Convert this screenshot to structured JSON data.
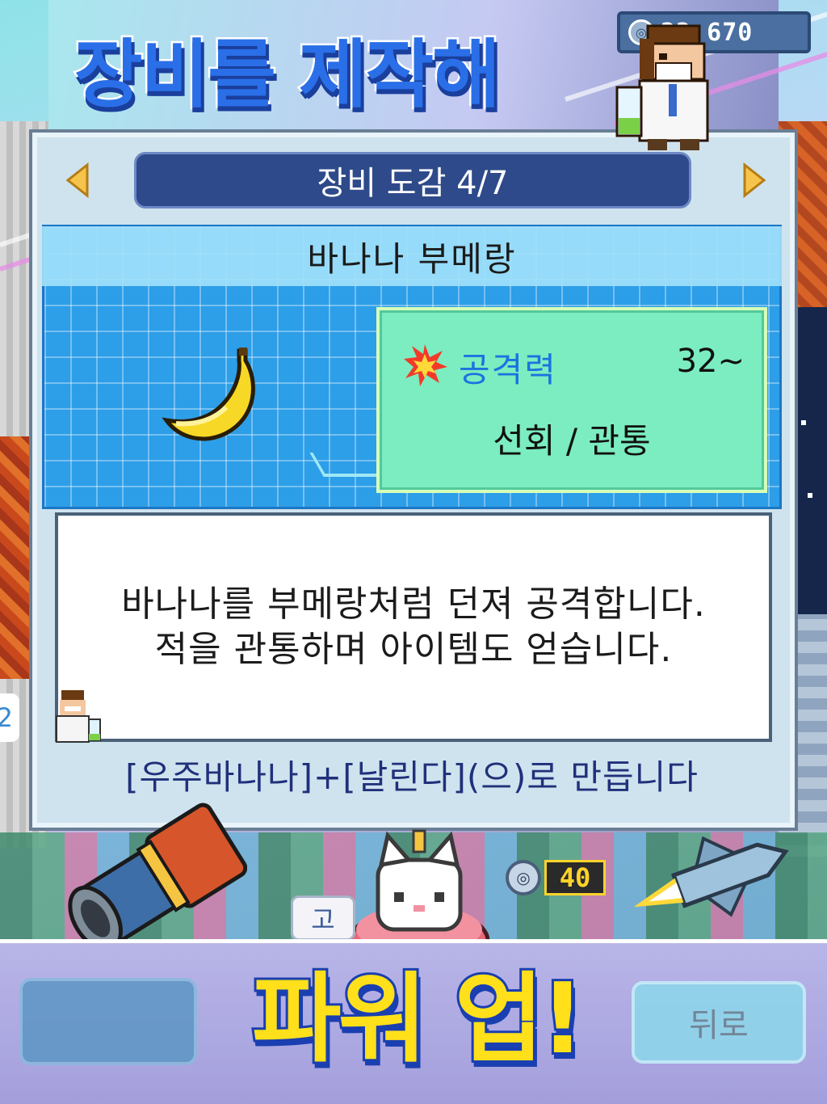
{
  "headline": "장비를 제작해",
  "coin_counter": {
    "value": "22,670",
    "icon": "coin-icon"
  },
  "panel": {
    "title": "장비 도감 4/7",
    "item_name": "바나나 부메랑",
    "stat": {
      "icon": "explosion-icon",
      "label": "공격력",
      "value": "32~",
      "traits": "선회 / 관통"
    },
    "description": [
      "바나나를 부메랑처럼 던져 공격합니다.",
      "적을 관통하며 아이템도 얻습니다."
    ],
    "recipe": "[우주바나나]+[날린다](으)로 만듭니다",
    "nav": {
      "prev_icon": "arrow-left-icon",
      "next_icon": "arrow-right-icon"
    }
  },
  "bottom": {
    "powerup_text": "파워 업!",
    "back_button": "뒤로",
    "level_badge": "40",
    "side_label": "고",
    "edge_label": "2"
  },
  "colors": {
    "headline": "#2a6fe8",
    "powerup": "#ffe01a",
    "title_bar": "#2e4a8a",
    "grid": "#2d9ee8",
    "stat_card": "#7bedc0",
    "stat_label": "#1d72e0"
  }
}
